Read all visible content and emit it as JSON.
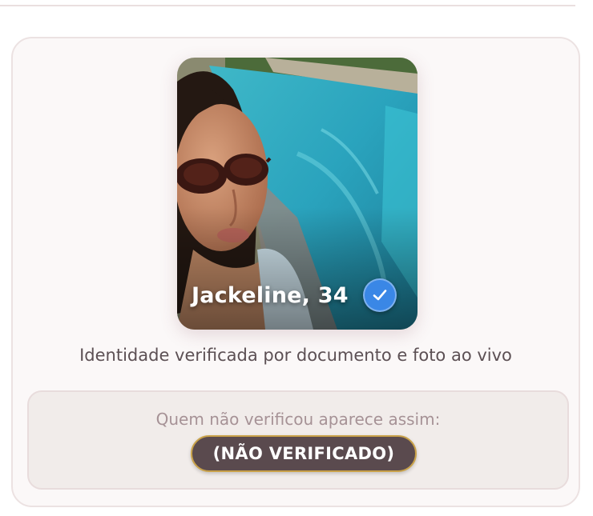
{
  "profile": {
    "name_age": "Jackeline, 34",
    "verified_icon": "check-icon",
    "photo_alt": "Profile photo"
  },
  "caption": "Identidade verificada por documento e foto ao vivo",
  "example": {
    "label": "Quem não verificou aparece assim:",
    "tag": "(NÃO VERIFICADO)"
  },
  "colors": {
    "verified_badge": "#3a87e6",
    "tag_background": "#5a4a4e",
    "tag_border": "#c9a24a"
  }
}
